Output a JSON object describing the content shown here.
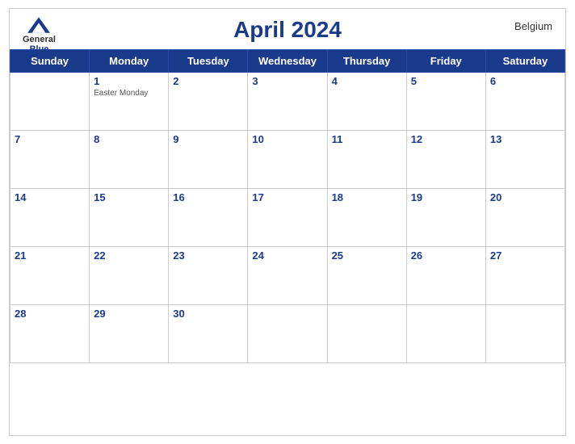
{
  "header": {
    "title": "April 2024",
    "country": "Belgium",
    "logo_general": "General",
    "logo_blue": "Blue"
  },
  "weekdays": [
    "Sunday",
    "Monday",
    "Tuesday",
    "Wednesday",
    "Thursday",
    "Friday",
    "Saturday"
  ],
  "weeks": [
    [
      {
        "day": "",
        "holiday": ""
      },
      {
        "day": "1",
        "holiday": "Easter Monday"
      },
      {
        "day": "2",
        "holiday": ""
      },
      {
        "day": "3",
        "holiday": ""
      },
      {
        "day": "4",
        "holiday": ""
      },
      {
        "day": "5",
        "holiday": ""
      },
      {
        "day": "6",
        "holiday": ""
      }
    ],
    [
      {
        "day": "7",
        "holiday": ""
      },
      {
        "day": "8",
        "holiday": ""
      },
      {
        "day": "9",
        "holiday": ""
      },
      {
        "day": "10",
        "holiday": ""
      },
      {
        "day": "11",
        "holiday": ""
      },
      {
        "day": "12",
        "holiday": ""
      },
      {
        "day": "13",
        "holiday": ""
      }
    ],
    [
      {
        "day": "14",
        "holiday": ""
      },
      {
        "day": "15",
        "holiday": ""
      },
      {
        "day": "16",
        "holiday": ""
      },
      {
        "day": "17",
        "holiday": ""
      },
      {
        "day": "18",
        "holiday": ""
      },
      {
        "day": "19",
        "holiday": ""
      },
      {
        "day": "20",
        "holiday": ""
      }
    ],
    [
      {
        "day": "21",
        "holiday": ""
      },
      {
        "day": "22",
        "holiday": ""
      },
      {
        "day": "23",
        "holiday": ""
      },
      {
        "day": "24",
        "holiday": ""
      },
      {
        "day": "25",
        "holiday": ""
      },
      {
        "day": "26",
        "holiday": ""
      },
      {
        "day": "27",
        "holiday": ""
      }
    ],
    [
      {
        "day": "28",
        "holiday": ""
      },
      {
        "day": "29",
        "holiday": ""
      },
      {
        "day": "30",
        "holiday": ""
      },
      {
        "day": "",
        "holiday": ""
      },
      {
        "day": "",
        "holiday": ""
      },
      {
        "day": "",
        "holiday": ""
      },
      {
        "day": "",
        "holiday": ""
      }
    ]
  ]
}
